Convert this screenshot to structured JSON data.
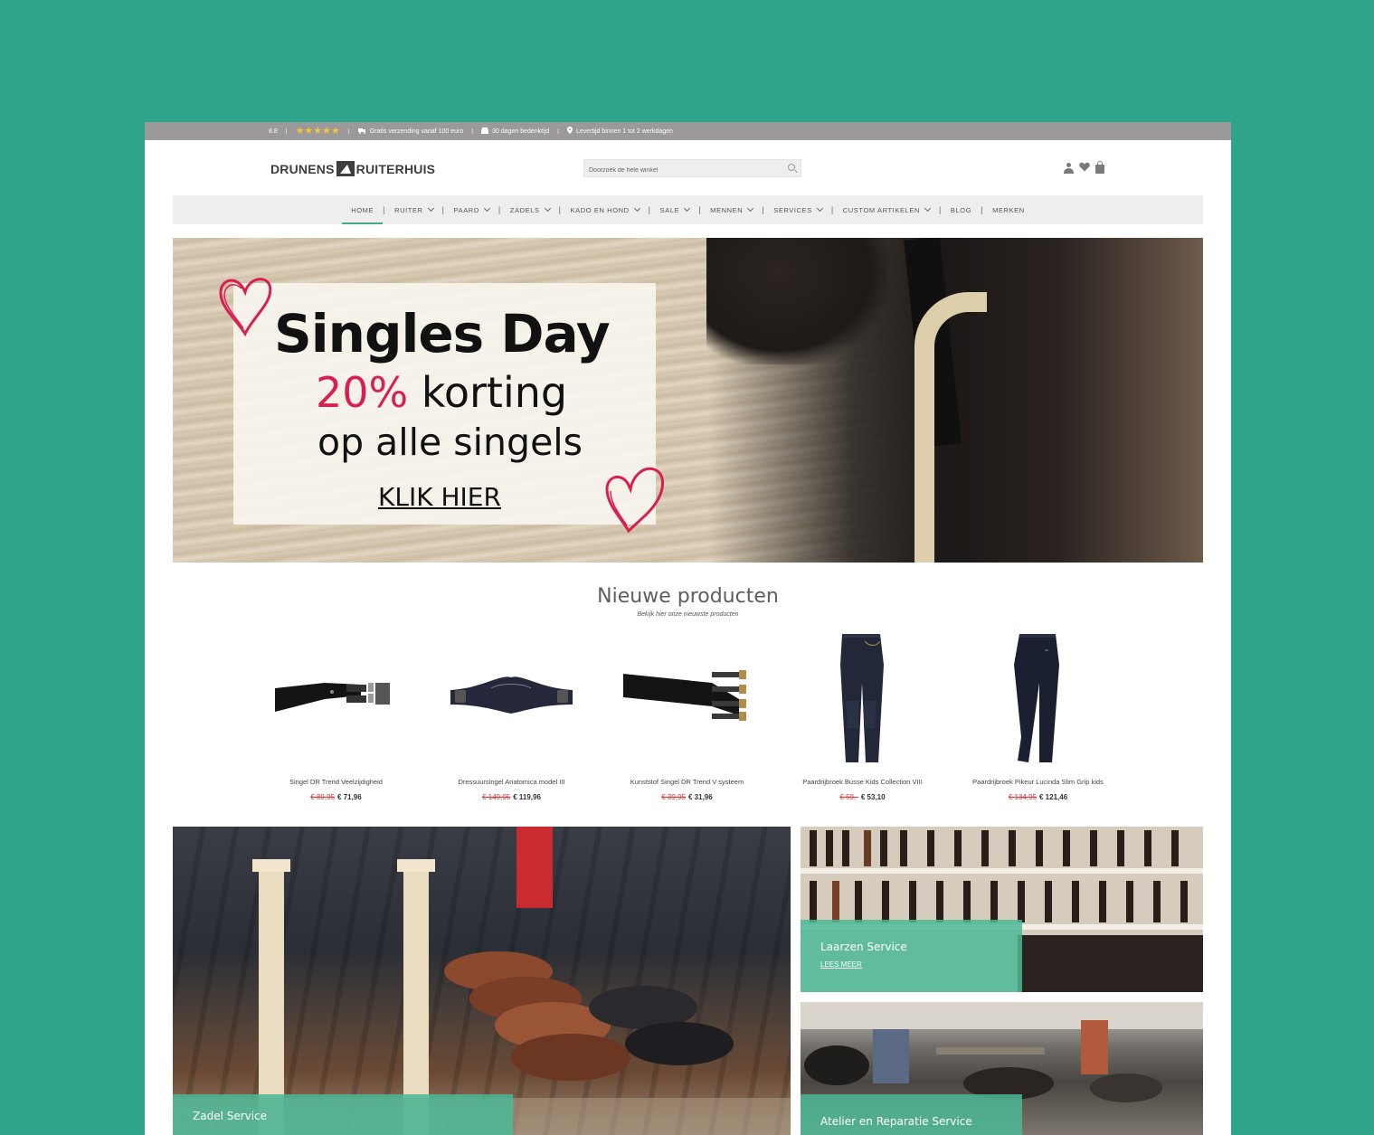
{
  "topbar": {
    "rating": "8.8",
    "stars": "★★★★★",
    "shipping": "Gratis verzending vanaf 100 euro",
    "returns": "30 dagen bedenktijd",
    "delivery": "Levertijd binnen 1 tot 2 werkdagen"
  },
  "header": {
    "logo_left": "DRUNENS",
    "logo_right": "RUITERHUIS",
    "search_placeholder": "Doorzoek de hele winkel"
  },
  "nav": {
    "items": [
      {
        "label": "HOME",
        "active": true
      },
      {
        "label": "RUITER"
      },
      {
        "label": "PAARD"
      },
      {
        "label": "ZADELS"
      },
      {
        "label": "KADO EN HOND"
      },
      {
        "label": "SALE"
      },
      {
        "label": "MENNEN"
      },
      {
        "label": "SERVICES"
      },
      {
        "label": "CUSTOM ARTIKELEN"
      },
      {
        "label": "BLOG"
      },
      {
        "label": "MERKEN"
      }
    ]
  },
  "hero": {
    "title": "Singles Day",
    "discount": "20%",
    "discount_rest": "korting",
    "line3": "op alle singels",
    "cta": "KLIK HIER"
  },
  "new_products": {
    "title": "Nieuwe producten",
    "subtitle": "Bekijk hier onze nieuwste producten",
    "items": [
      {
        "name": "Singel DR Trend Veelzijdigheid",
        "old_price": "€ 89,95",
        "price": "€ 71,96"
      },
      {
        "name": "Dressuursingel Anatomica model III",
        "old_price": "€ 149,95",
        "price": "€ 119,96"
      },
      {
        "name": "Kunststof Singel DR Trend V systeem",
        "old_price": "€ 39,95",
        "price": "€ 31,96"
      },
      {
        "name": "Paardrijbroek Busse Kids Collection VIII",
        "old_price": "€ 59,-",
        "price": "€ 53,10"
      },
      {
        "name": "Paardrijbroek Pikeur Lucinda Slim Grip kids",
        "old_price": "€ 134,95",
        "price": "€ 121,46"
      }
    ]
  },
  "tiles": {
    "zadel": {
      "title": "Zadel Service"
    },
    "laarzen": {
      "title": "Laarzen Service",
      "link": "LEES MEER"
    },
    "atelier": {
      "title": "Atelier en Reparatie Service"
    }
  },
  "colors": {
    "background": "#2ea48a",
    "accent": "#48a896",
    "sale_red": "#d23b3b",
    "hero_pink": "#d6204f"
  }
}
